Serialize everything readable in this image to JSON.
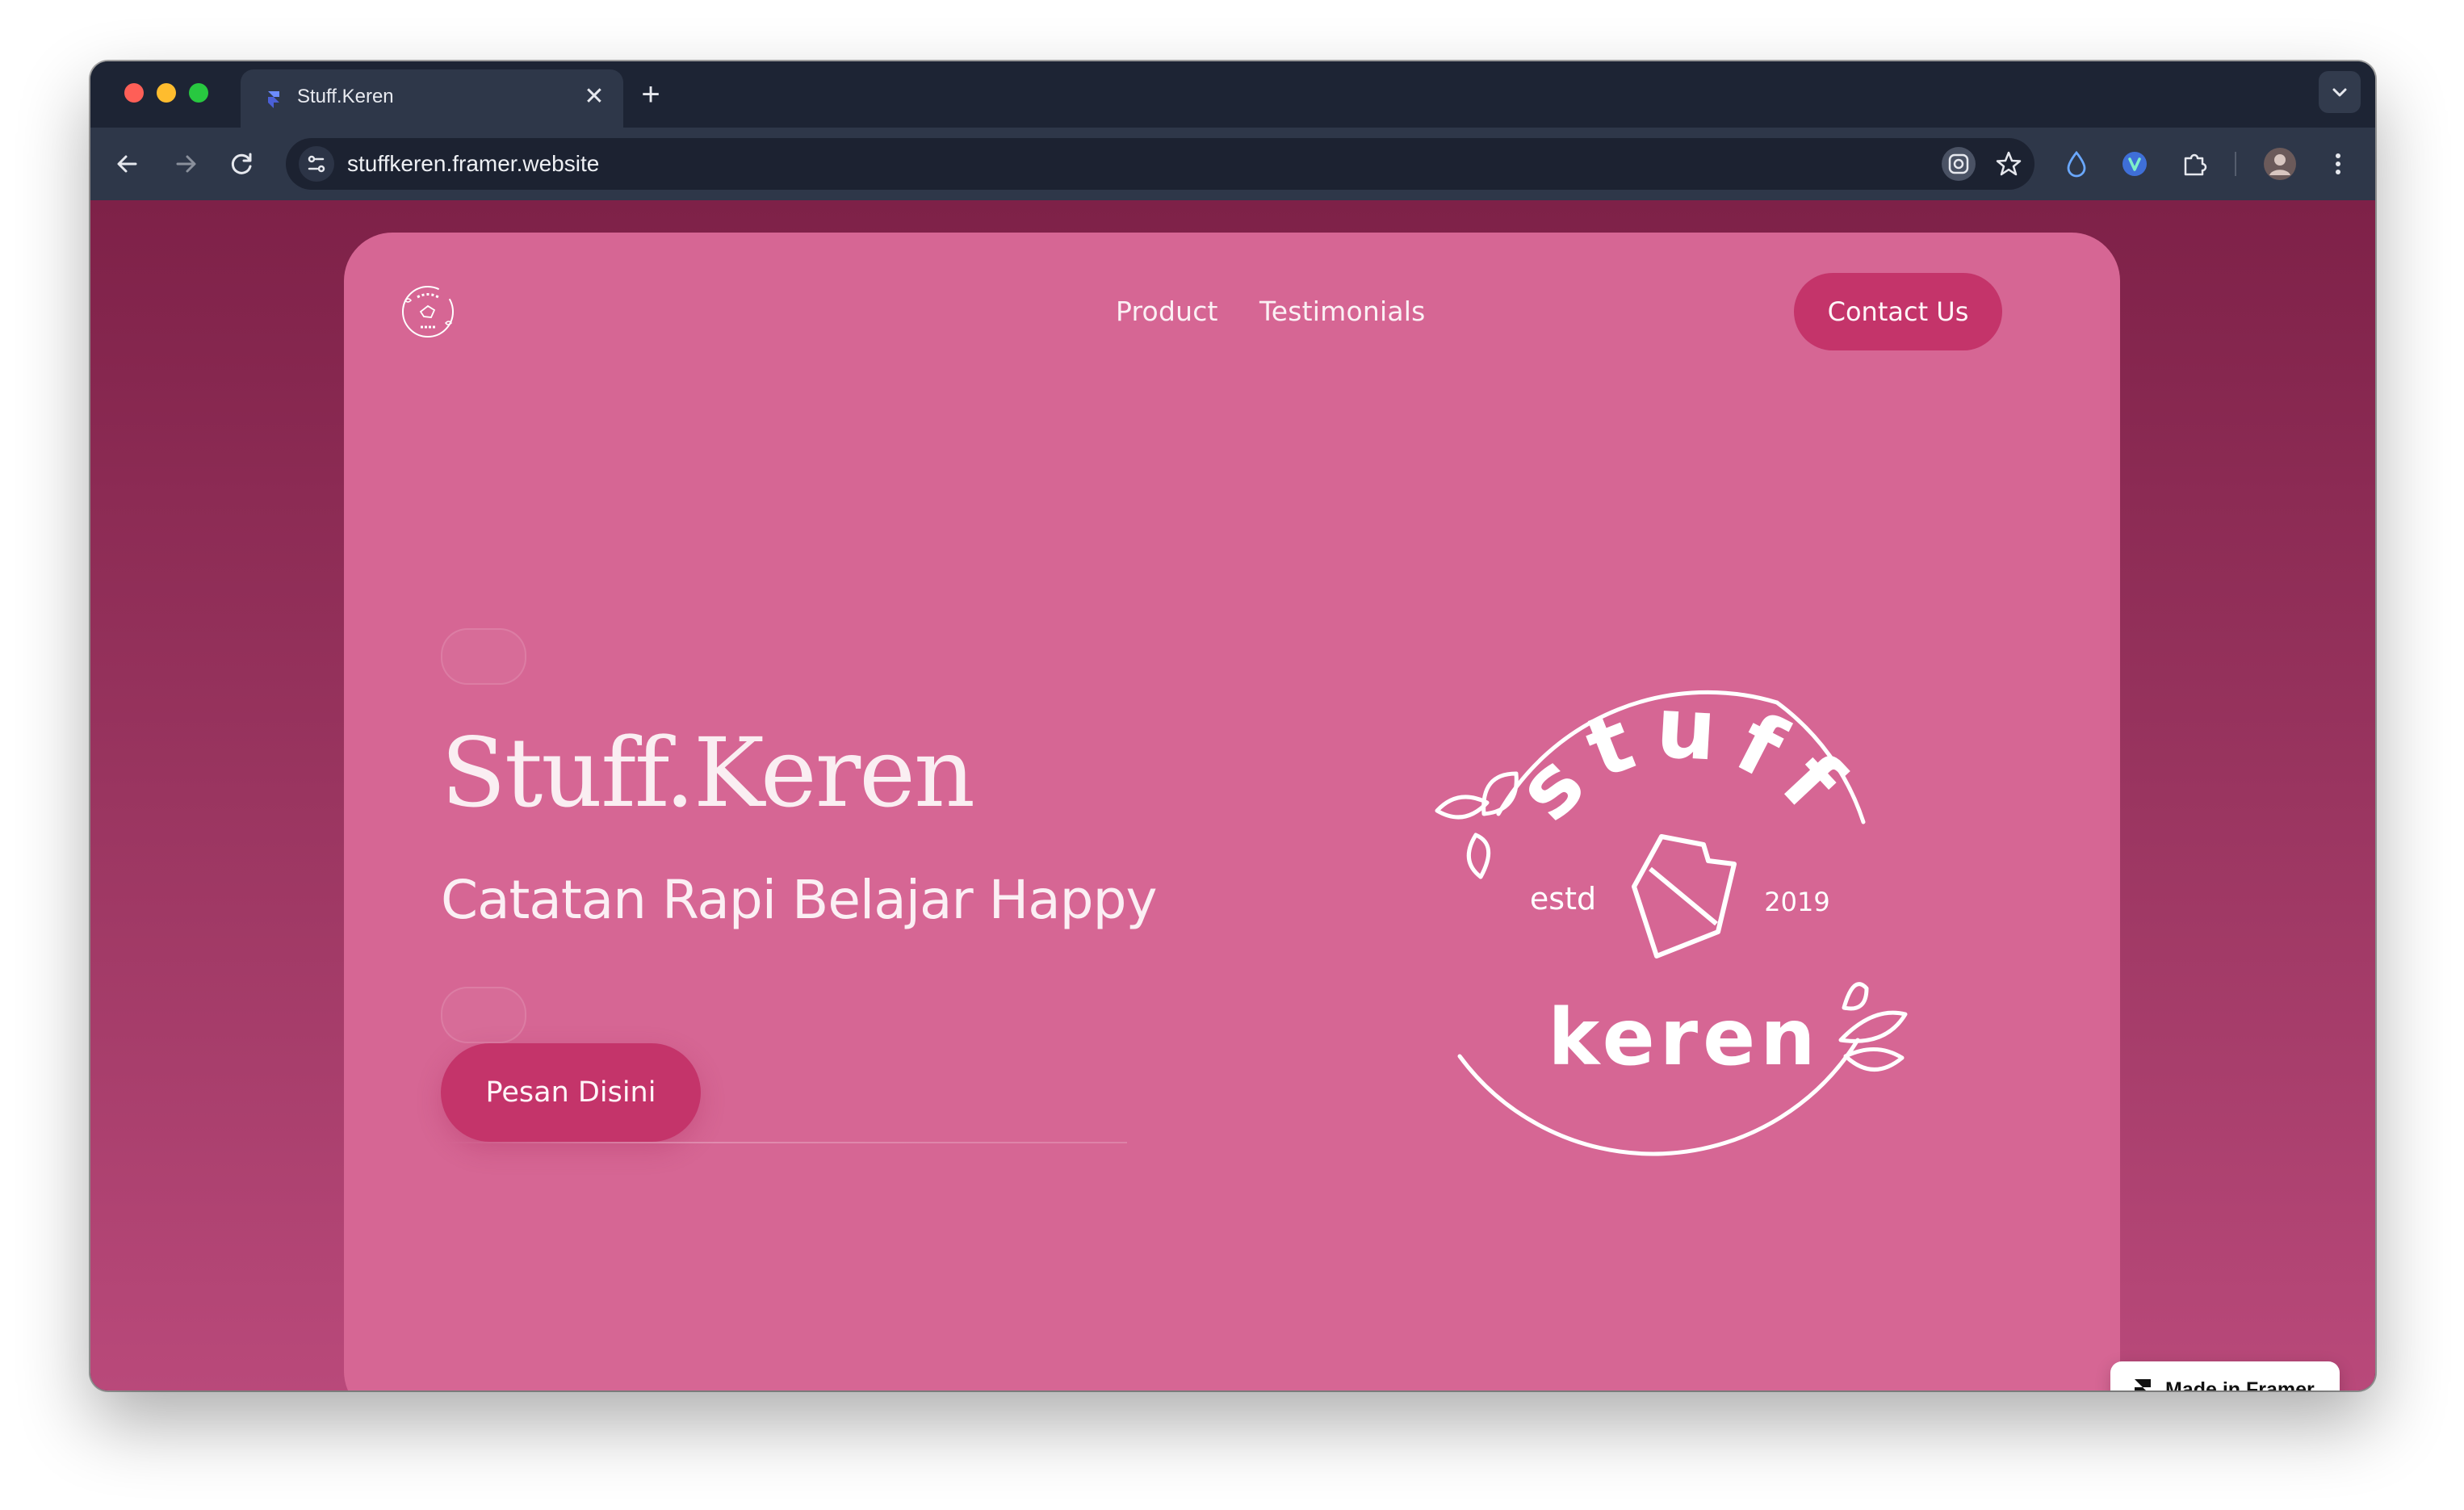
{
  "browser": {
    "tab": {
      "title": "Stuff.Keren",
      "favicon": "framer-favicon-icon"
    },
    "url": "stuffkeren.framer.website",
    "colors": {
      "frame": "#1d2434",
      "toolbar": "#2e3749",
      "omnibox": "#1c2231"
    }
  },
  "site": {
    "nav": {
      "links": [
        "Product",
        "Testimonials"
      ],
      "cta": "Contact Us"
    },
    "hero": {
      "title": "Stuff.Keren",
      "subtitle": "Catatan Rapi Belajar Happy",
      "button": "Pesan Disini"
    },
    "logo": {
      "top_text": "stuff",
      "bottom_text": "keren",
      "left_text": "estd",
      "right_text": "2019"
    },
    "colors": {
      "background": "#8a2a52",
      "card": "#d66694",
      "accent": "#c4346a",
      "text": "#faeef2"
    }
  },
  "badge": {
    "label": "Made in Framer"
  }
}
